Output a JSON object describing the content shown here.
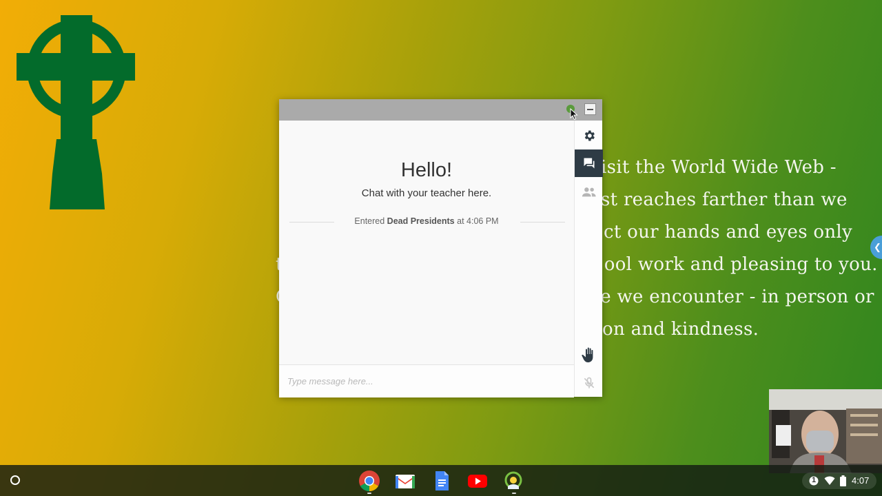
{
  "desktop": {
    "background_colors": [
      "#f2ad06",
      "#2f861f"
    ],
    "cross_color": "#036b2b",
    "prayer_lines": [
      "isit the World Wide Web -",
      "st reaches farther than we",
      "ct our hands and eyes only",
      "ool work and pleasing to you.",
      "e we encounter - in person or",
      "on and kindness."
    ],
    "left_fragments": [
      "t",
      "C"
    ]
  },
  "chat_window": {
    "greeting": "Hello!",
    "subtitle": "Chat with your teacher here.",
    "entered_prefix": "Entered",
    "entered_room": "Dead Presidents",
    "entered_suffix": "at 4:06 PM",
    "message_placeholder": "Type message here...",
    "message_value": "",
    "rail_icons": [
      "gear-icon",
      "chat-icon",
      "people-icon",
      "raise-hand-icon",
      "mic-off-icon"
    ],
    "active_rail": "chat",
    "rail_active_color": "#2e3b45"
  },
  "taskbar": {
    "apps": [
      "Chrome",
      "Gmail",
      "Docs",
      "YouTube",
      "Classroom app"
    ],
    "notification_count": "1",
    "time": "4:07"
  }
}
